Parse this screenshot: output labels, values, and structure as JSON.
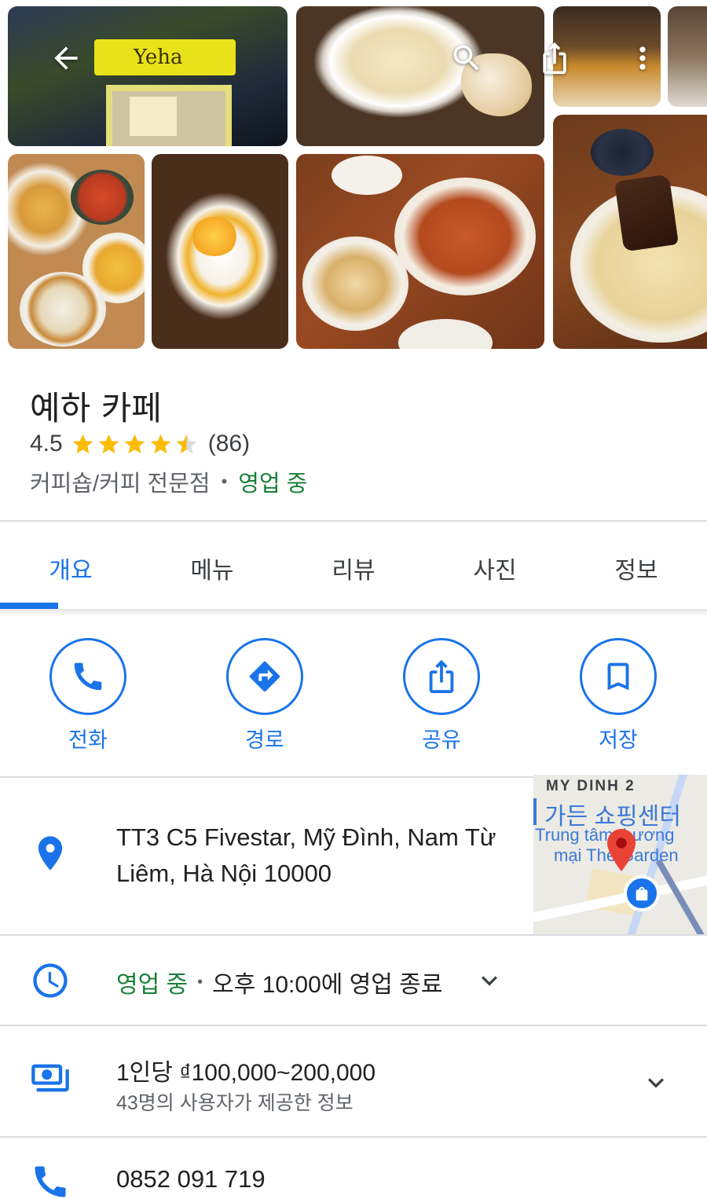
{
  "place": {
    "name": "예하 카페",
    "rating": "4.5",
    "rating_stars": 4.5,
    "review_count": "(86)",
    "category": "커피숍/커피 전문점",
    "open_status": "영업 중"
  },
  "tabs": [
    {
      "label": "개요",
      "active": true
    },
    {
      "label": "메뉴",
      "active": false
    },
    {
      "label": "리뷰",
      "active": false
    },
    {
      "label": "사진",
      "active": false
    },
    {
      "label": "정보",
      "active": false
    }
  ],
  "actions": [
    {
      "label": "전화",
      "icon": "phone-icon"
    },
    {
      "label": "경로",
      "icon": "directions-icon"
    },
    {
      "label": "공유",
      "icon": "share-icon"
    },
    {
      "label": "저장",
      "icon": "bookmark-icon"
    }
  ],
  "address": {
    "text": "TT3 C5 Fivestar, Mỹ Đình, Nam Từ Liêm, Hà Nội 10000",
    "icon": "location-pin-icon"
  },
  "map_preview": {
    "area_label": "MY DINH 2",
    "poi_korean": "가든 쇼핑센터",
    "poi_line1": "Trung tâm thương",
    "poi_line2": "mại The Garden"
  },
  "hours": {
    "status": "영업 중",
    "closing": "오후 10:00에 영업 종료",
    "icon": "clock-icon"
  },
  "price": {
    "range": "1인당 ₫100,000~200,000",
    "source": "43명의 사용자가 제공한 정보",
    "icon": "money-icon"
  },
  "phone": {
    "number": "0852 091 719",
    "icon": "phone-icon"
  },
  "gallery": {
    "storefront_sign": "Yeha"
  },
  "colors": {
    "accent": "#1a73e8",
    "open": "#188038",
    "star": "#fbbc04",
    "divider": "#dadce0"
  }
}
